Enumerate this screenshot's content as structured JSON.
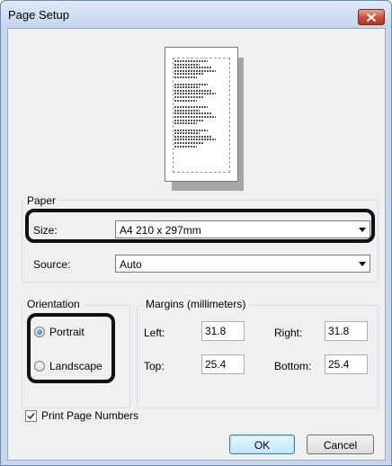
{
  "window": {
    "title": "Page Setup"
  },
  "paper": {
    "group_label": "Paper",
    "size_label": "Size:",
    "size_value": "A4 210 x 297mm",
    "source_label": "Source:",
    "source_value": "Auto"
  },
  "orientation": {
    "group_label": "Orientation",
    "portrait_label": "Portrait",
    "landscape_label": "Landscape",
    "selected": "Portrait"
  },
  "margins": {
    "group_label": "Margins (millimeters)",
    "left_label": "Left:",
    "left_value": "31.8",
    "right_label": "Right:",
    "right_value": "31.8",
    "top_label": "Top:",
    "top_value": "25.4",
    "bottom_label": "Bottom:",
    "bottom_value": "25.4"
  },
  "print_page_numbers": {
    "label": "Print Page Numbers",
    "checked": true
  },
  "buttons": {
    "ok": "OK",
    "cancel": "Cancel"
  },
  "icons": {
    "close": "close-icon",
    "checkmark": "checkmark-icon",
    "dropdown": "chevron-down-icon"
  }
}
